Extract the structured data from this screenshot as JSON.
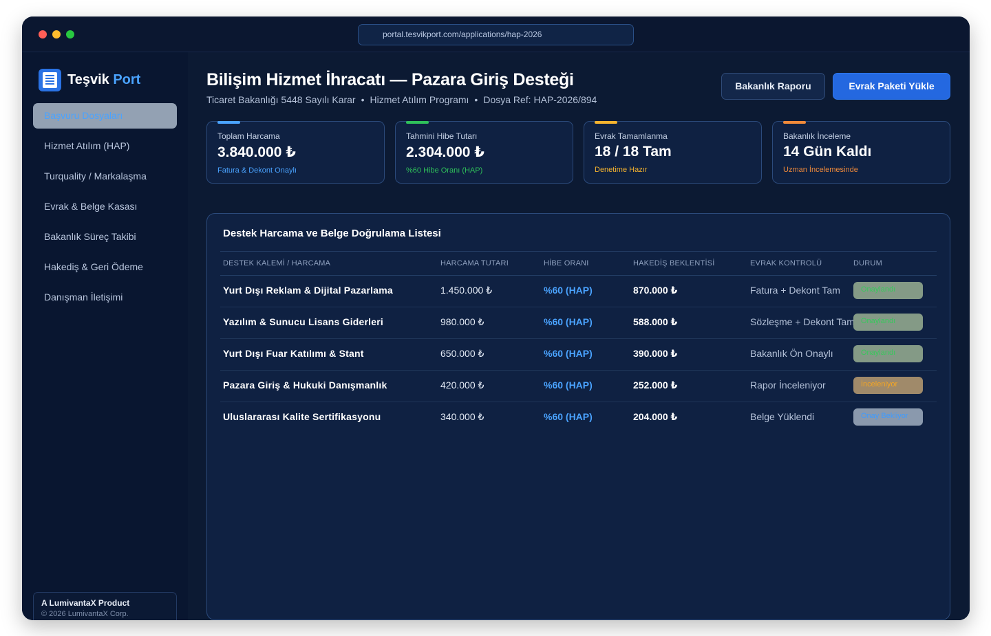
{
  "browser": {
    "url": "portal.tesvikport.com/applications/hap-2026"
  },
  "sidebar": {
    "brand": {
      "name": "Teşvik",
      "accent": "Port"
    },
    "items": [
      {
        "label": "Başvuru Dosyaları",
        "active": true
      },
      {
        "label": "Hizmet Atılım (HAP)"
      },
      {
        "label": "Turquality / Markalaşma"
      },
      {
        "label": "Evrak & Belge Kasası"
      },
      {
        "label": "Bakanlık Süreç Takibi"
      },
      {
        "label": "Hakediş & Geri Ödeme"
      },
      {
        "label": "Danışman İletişimi"
      }
    ],
    "footer": {
      "title": "A LumivantaX Product",
      "copyright": "© 2026 LumivantaX Corp."
    }
  },
  "header": {
    "title": "Bilişim Hizmet İhracatı — Pazara Giriş Desteği",
    "subtitle": [
      "Ticaret Bakanlığı 5448 Sayılı Karar",
      "Hizmet Atılım Programı",
      "Dosya Ref: HAP-2026/894"
    ],
    "separator": "•",
    "secondary_button": "Bakanlık Raporu",
    "primary_button": "Evrak Paketi Yükle"
  },
  "stats": [
    {
      "label": "Toplam Harcama",
      "value": "3.840.000 ₺",
      "note": "Fatura & Dekont Onaylı",
      "color": "#4aa3ff"
    },
    {
      "label": "Tahmini Hibe Tutarı",
      "value": "2.304.000 ₺",
      "note": "%60 Hibe Oranı (HAP)",
      "color": "#2fc05a"
    },
    {
      "label": "Evrak Tamamlanma",
      "value": "18 / 18 Tam",
      "note": "Denetime Hazır",
      "color": "#f5b32e"
    },
    {
      "label": "Bakanlık İnceleme",
      "value": "14 Gün Kaldı",
      "note": "Uzman İncelemesinde",
      "color": "#f08a3a"
    }
  ],
  "table": {
    "title": "Destek Harcama ve Belge Doğrulama Listesi",
    "columns": [
      "DESTEK KALEMİ / HARCAMA",
      "HARCAMA TUTARI",
      "HİBE ORANI",
      "HAKEDİŞ BEKLENTİSİ",
      "EVRAK KONTROLÜ",
      "DURUM"
    ],
    "rows": [
      {
        "item": "Yurt Dışı Reklam & Dijital Pazarlama",
        "amount": "1.450.000 ₺",
        "rate": "%60 (HAP)",
        "hakedis": "870.000 ₺",
        "docs": "Fatura + Dekont Tam",
        "status": "Onaylandı",
        "status_type": "approved"
      },
      {
        "item": "Yazılım & Sunucu Lisans Giderleri",
        "amount": "980.000 ₺",
        "rate": "%60 (HAP)",
        "hakedis": "588.000 ₺",
        "docs": "Sözleşme + Dekont Tam",
        "status": "Onaylandı",
        "status_type": "approved"
      },
      {
        "item": "Yurt Dışı Fuar Katılımı & Stant",
        "amount": "650.000 ₺",
        "rate": "%60 (HAP)",
        "hakedis": "390.000 ₺",
        "docs": "Bakanlık Ön Onaylı",
        "status": "Onaylandı",
        "status_type": "approved"
      },
      {
        "item": "Pazara Giriş & Hukuki Danışmanlık",
        "amount": "420.000 ₺",
        "rate": "%60 (HAP)",
        "hakedis": "252.000 ₺",
        "docs": "Rapor İnceleniyor",
        "status": "İnceleniyor",
        "status_type": "review"
      },
      {
        "item": "Uluslararası Kalite Sertifikasyonu",
        "amount": "340.000 ₺",
        "rate": "%60 (HAP)",
        "hakedis": "204.000 ₺",
        "docs": "Belge Yüklendi",
        "status": "Onay Bekliyor",
        "status_type": "pending"
      }
    ]
  },
  "status_colors": {
    "approved": {
      "bg": "#849a86",
      "fg": "#37c85c"
    },
    "review": {
      "bg": "#a08a6a",
      "fg": "#f5a623"
    },
    "pending": {
      "bg": "#8a99ad",
      "fg": "#3e9bff"
    }
  }
}
